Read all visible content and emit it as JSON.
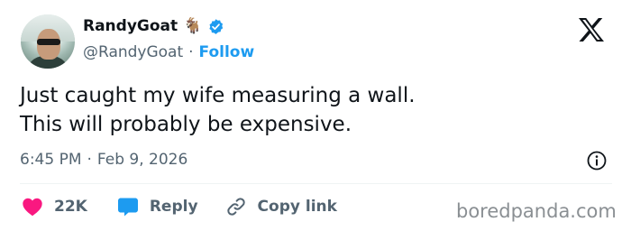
{
  "author": {
    "display_name": "RandyGoat",
    "name_emoji": "🐐",
    "handle": "@RandyGoat",
    "follow_label": "Follow",
    "verified_color": "#1d9bf0"
  },
  "tweet": {
    "line1": "Just caught my wife measuring a wall.",
    "line2": "This will probably be expensive.",
    "time": "6:45 PM",
    "date": "Feb 9, 2026"
  },
  "actions": {
    "likes_count": "22K",
    "like_color": "#f91880",
    "reply_label": "Reply",
    "reply_color": "#1d9bf0",
    "copy_label": "Copy link"
  },
  "watermark": "boredpanda.com",
  "icons": [
    "avatar",
    "goat-emoji",
    "verified-badge-icon",
    "x-logo-icon",
    "info-icon",
    "heart-icon",
    "reply-bubble-icon",
    "link-icon"
  ]
}
